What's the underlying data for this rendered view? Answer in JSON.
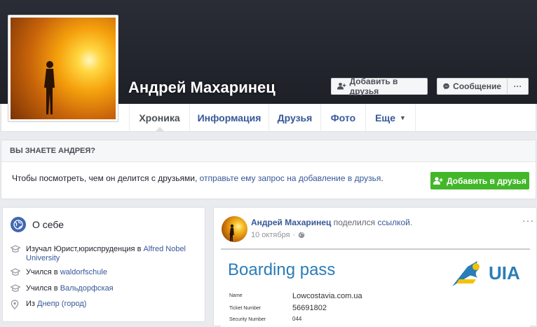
{
  "profile": {
    "name": "Андрей Махаринец",
    "add_friend_label": "Добавить в друзья",
    "message_label": "Сообщение",
    "more_label": "···"
  },
  "tabs": [
    {
      "label": "Хроника"
    },
    {
      "label": "Информация"
    },
    {
      "label": "Друзья"
    },
    {
      "label": "Фото"
    },
    {
      "label": "Еще"
    }
  ],
  "know": {
    "heading": "ВЫ ЗНАЕТЕ АНДРЕЯ?",
    "text": "Чтобы посмотреть, чем он делится с друзьями, ",
    "link": "отправьте ему запрос на добавление в друзья",
    "text_end": ".",
    "button": "Добавить в друзья"
  },
  "intro": {
    "title": "О себе",
    "items": [
      {
        "prefix": "Изучал Юрист,юриспруденция в ",
        "link": "Alfred Nobel University"
      },
      {
        "prefix": "Учился в ",
        "link": "waldorfschule"
      },
      {
        "prefix": "Учился в ",
        "link": "Вальдорфская"
      },
      {
        "prefix": "Из ",
        "link": "Днепр (город)"
      }
    ]
  },
  "post": {
    "author": "Андрей Махаринец",
    "action": " поделился ",
    "object": "ссылкой",
    "action_end": ".",
    "date": "10 октября",
    "dots": "···",
    "boarding": {
      "title": "Boarding pass",
      "logo_text": "UIA",
      "rows": [
        {
          "label": "Name",
          "value": "Lowcostavia.com.ua"
        },
        {
          "label": "Ticket Number",
          "value": "56691802"
        },
        {
          "label": "Security Number",
          "value": "044"
        }
      ]
    }
  },
  "colors": {
    "link": "#365899",
    "green": "#42b72a",
    "uia_blue": "#2b7db8",
    "uia_yellow": "#f4c200"
  }
}
